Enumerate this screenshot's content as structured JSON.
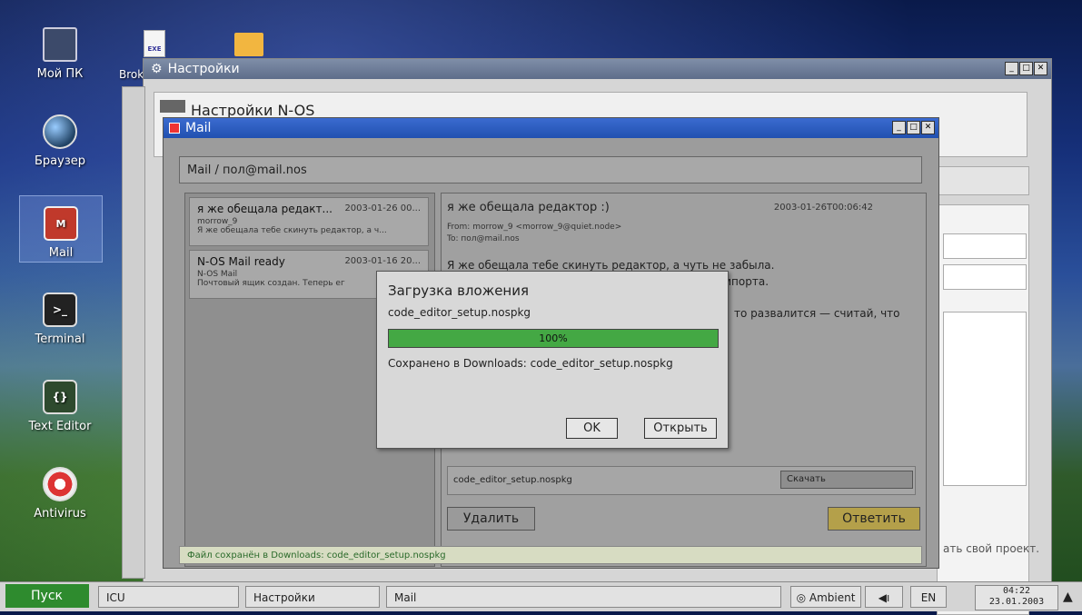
{
  "desktop": {
    "icons": [
      {
        "label": "Мой ПК",
        "icon": "computer-icon"
      },
      {
        "label": "Браузер",
        "icon": "globe-icon"
      },
      {
        "label": "Mail",
        "icon": "mail-icon",
        "glyph": "M"
      },
      {
        "label": "Terminal",
        "icon": "terminal-icon",
        "glyph": ">_"
      },
      {
        "label": "Text Editor",
        "icon": "braces-icon",
        "glyph": "{}"
      },
      {
        "label": "Antivirus",
        "icon": "lifebuoy-icon"
      }
    ],
    "top_files": [
      {
        "label": "EXE",
        "icon": "exe-file-icon"
      },
      {
        "icon": "folder-icon"
      }
    ],
    "brok_label": "Brok"
  },
  "settings": {
    "title": "Настройки",
    "heading": "Настройки N-OS",
    "footer_text": "ать свой проект."
  },
  "mail": {
    "title": "Mail",
    "account": "Mail / пол@mail.nos",
    "list": [
      {
        "subject": "я же обещала редакт...",
        "date": "2003-01-26 00...",
        "sender": "morrow_9",
        "preview": "Я же обещала тебе скинуть редактор, а ч..."
      },
      {
        "subject": "N-OS Mail ready",
        "date": "2003-01-16 20...",
        "sender": "N-OS Mail",
        "preview": "Почтовый ящик создан. Теперь ег"
      }
    ],
    "message": {
      "subject": "я же обещала редактор :)",
      "date": "2003-01-26T00:06:42",
      "from": "From: morrow_9 <morrow_9@quiet.node>",
      "to": "To: пол@mail.nos",
      "body1": "Я же обещала тебе скинуть редактор, а чуть не забыла.",
      "body2": "мпорта.",
      "body3": "то развалится — считай, что",
      "attachment": "code_editor_setup.nospkg",
      "download_label": "Скачать",
      "delete_label": "Удалить",
      "reply_label": "Ответить"
    },
    "status": "Файл сохранён в Downloads: code_editor_setup.nospkg"
  },
  "dialog": {
    "title": "Загрузка вложения",
    "filename": "code_editor_setup.nospkg",
    "progress": 1.0,
    "progress_label": "100%",
    "saved_text": "Сохранено в Downloads: code_editor_setup.nospkg",
    "ok_label": "OK",
    "open_label": "Открыть"
  },
  "taskbar": {
    "start_label": "Пуск",
    "tasks": [
      "ICU",
      "Настройки",
      "Mail"
    ],
    "ambient_label": "Ambient",
    "lang": "EN",
    "time": "04:22",
    "date": "23.01.2003"
  },
  "colors": {
    "progress": "#44a844",
    "start": "#2e8b2e",
    "mail_titlebar": "#2150b0"
  }
}
